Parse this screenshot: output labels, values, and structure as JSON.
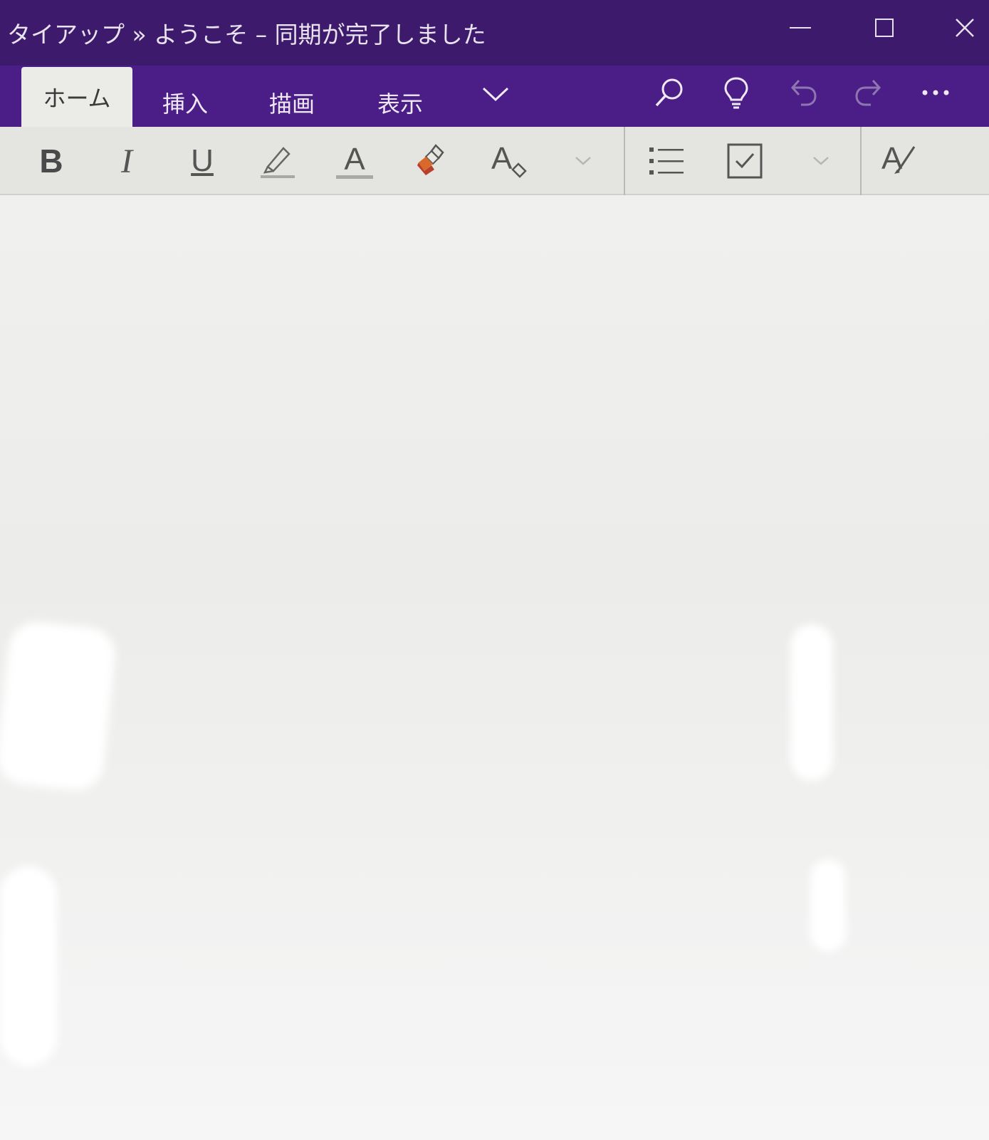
{
  "window": {
    "title": "タイアップ » ようこそ – 同期が完了しました",
    "controls": [
      "minimize-icon",
      "maximize-icon",
      "close-icon"
    ]
  },
  "tabs": [
    {
      "label": "ホーム",
      "active": true
    },
    {
      "label": "挿入",
      "active": false
    },
    {
      "label": "描画",
      "active": false
    },
    {
      "label": "表示",
      "active": false
    }
  ],
  "ribbon_icons": [
    "chevron-down-icon",
    "search-icon",
    "lightbulb-icon",
    "undo-icon",
    "redo-icon",
    "more-icon"
  ],
  "toolbar": {
    "bold": "B",
    "italic": "I",
    "underline": "U",
    "font_color": "A",
    "styles": "A",
    "spelling": "A"
  },
  "colors": {
    "title_bar": "#3d1a6b",
    "tab_bar": "#4a1e86",
    "toolbar": "#e4e4e1",
    "canvas": "#f0f0ee"
  }
}
